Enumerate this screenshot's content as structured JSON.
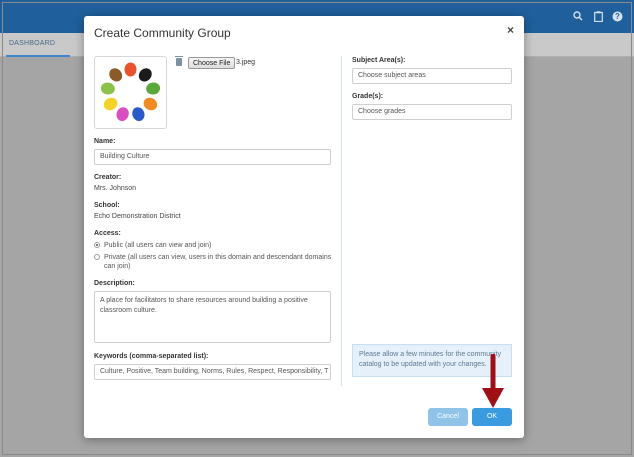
{
  "app": {
    "tab_label": "DASHBOARD",
    "icons": [
      "search-icon",
      "clipboard-icon",
      "help-icon"
    ]
  },
  "modal": {
    "title": "Create Community Group",
    "close_label": "×",
    "avatar_icon": "colorful-hands-circle-image",
    "choose_file_label": "Choose File",
    "file_name": "3.jpeg",
    "name": {
      "label": "Name:",
      "value": "Building Culture"
    },
    "creator": {
      "label": "Creator:",
      "value": "Mrs. Johnson"
    },
    "school": {
      "label": "School:",
      "value": "Echo Demonstration District"
    },
    "access": {
      "label": "Access:",
      "options": [
        {
          "label": "Public (all users can view and join)",
          "selected": true
        },
        {
          "label": "Private (all users can view, users in this domain and descendant domains can join)",
          "selected": false
        }
      ]
    },
    "description": {
      "label": "Description:",
      "value": "A place for facilitators to share resources around building a positive classroom culture."
    },
    "keywords": {
      "label": "Keywords (comma-separated list):",
      "value": "Culture, Positive, Team building, Norms, Rules, Respect, Responsibility, T"
    },
    "subject_areas": {
      "label": "Subject Area(s):",
      "placeholder": "Choose subject areas"
    },
    "grades": {
      "label": "Grade(s):",
      "placeholder": "Choose grades"
    },
    "notice": "Please allow a few minutes for the community catalog to be updated with your changes.",
    "cancel_label": "Cancel",
    "ok_label": "OK"
  },
  "colors": {
    "topbar": "#1f5f9b",
    "primary_button": "#3b9be0",
    "secondary_button": "#8fc3e8",
    "annotation_arrow": "#a10f16"
  }
}
